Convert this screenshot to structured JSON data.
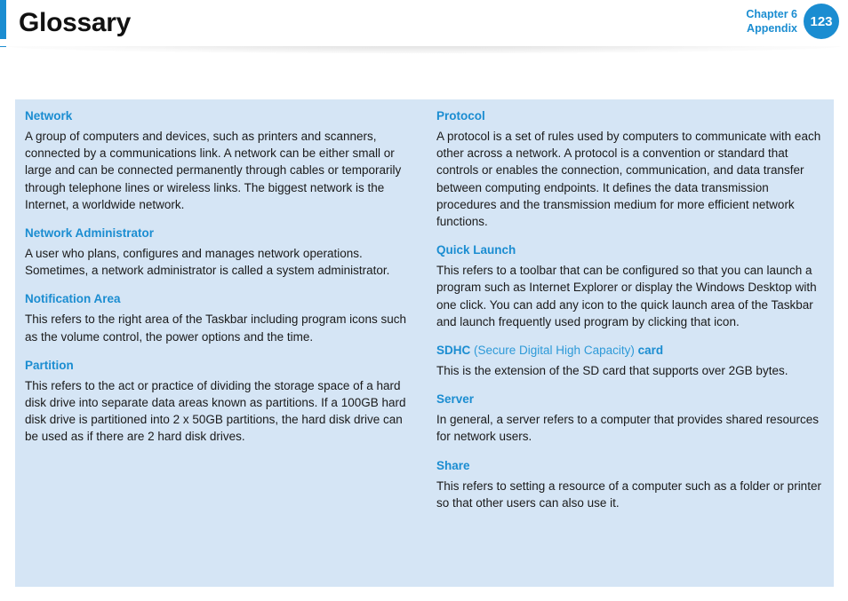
{
  "header": {
    "title": "Glossary",
    "chapter_line1": "Chapter 6",
    "chapter_line2": "Appendix",
    "page_number": "123",
    "accent_color": "#1b8dd1"
  },
  "panel": {
    "background_color": "#d5e5f5",
    "left_column": [
      {
        "term": "Network",
        "definition": "A group of computers and devices, such as printers and scanners, connected by a communications link. A network can be either small or large and can be connected permanently through cables or temporarily through telephone lines or wireless links. The biggest network is the Internet, a worldwide network."
      },
      {
        "term": "Network Administrator",
        "definition": "A user who plans, configures and manages network operations. Sometimes, a network administrator is called a system administrator."
      },
      {
        "term": "Notification Area",
        "definition": "This refers to the right area of the Taskbar including program icons such as the volume control, the power options and the time."
      },
      {
        "term": "Partition",
        "definition": "This refers to the act or practice of dividing the storage space of a hard disk drive into separate data areas known as partitions. If a 100GB hard disk drive is partitioned into 2 x 50GB partitions, the hard disk drive can be used as if there are 2 hard disk drives."
      }
    ],
    "right_column": [
      {
        "term": "Protocol",
        "definition": "A protocol is a set of rules used by computers to communicate with each other across a network. A protocol is a convention or standard that controls or enables the connection, communication, and data transfer between computing endpoints. It defines the data transmission procedures and the transmission medium for more efficient network functions."
      },
      {
        "term": "Quick Launch",
        "definition": "This refers to a toolbar that can be configured so that you can launch a program such as Internet Explorer or display the Windows Desktop with one click. You can add any icon to the quick launch area of the Taskbar and launch frequently used program by clicking that icon."
      },
      {
        "term": "SDHC",
        "term_sub": " (Secure Digital High Capacity) ",
        "term_tail": "card",
        "definition": "This is the extension of the SD card that supports over 2GB bytes."
      },
      {
        "term": "Server",
        "definition": "In general, a server refers to a computer that provides shared resources for network users."
      },
      {
        "term": "Share",
        "definition": "This refers to setting a resource of a computer such as a folder or printer so that other users can also use it."
      }
    ]
  }
}
